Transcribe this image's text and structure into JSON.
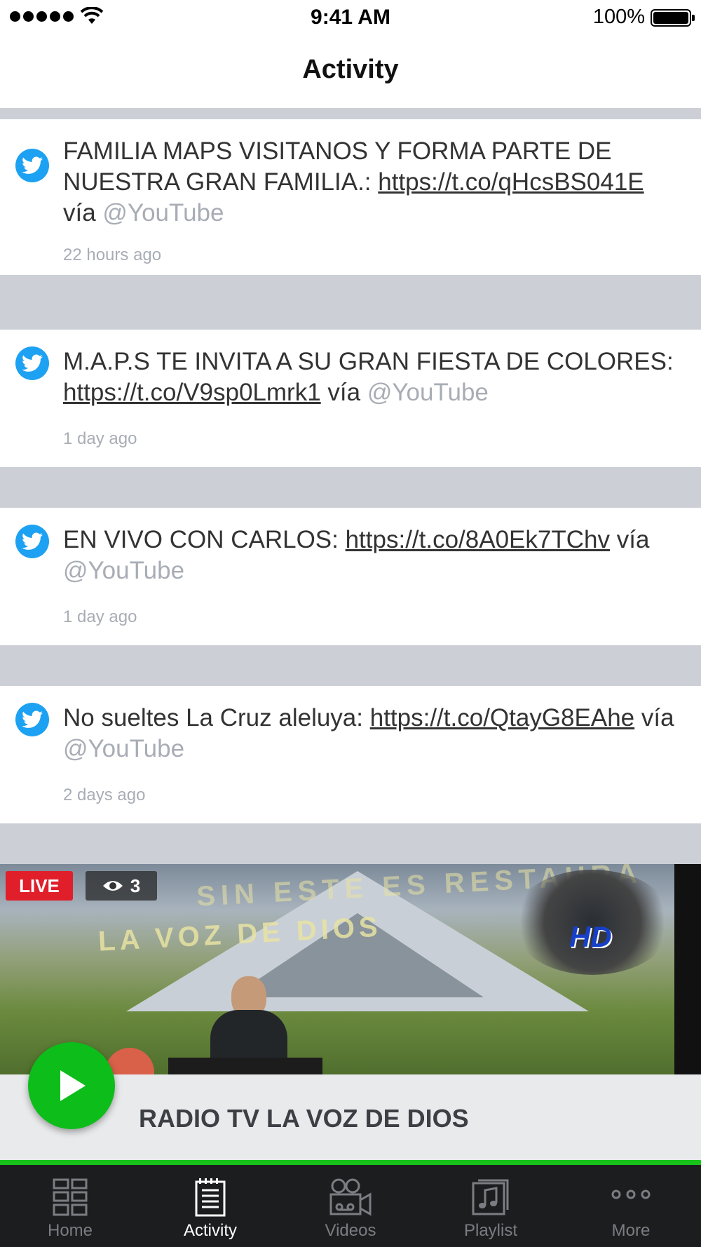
{
  "status_bar": {
    "time": "9:41 AM",
    "battery": "100%"
  },
  "header": {
    "title": "Activity"
  },
  "feed": [
    {
      "segments": [
        {
          "text": "FAMILIA MAPS VISITANOS Y FORMA PARTE DE NUESTRA GRAN FAMILIA.: ",
          "style": "plain"
        },
        {
          "text": "https://t.co/qHcsBS041E",
          "style": "link"
        },
        {
          "text": " vía ",
          "style": "plain"
        },
        {
          "text": "@YouTube",
          "style": "mention"
        }
      ],
      "time": "22 hours ago"
    },
    {
      "segments": [
        {
          "text": "M.A.P.S TE INVITA A SU GRAN FIESTA DE COLORES: ",
          "style": "plain"
        },
        {
          "text": "https://t.co/V9sp0Lmrk1",
          "style": "link"
        },
        {
          "text": " vía ",
          "style": "plain"
        },
        {
          "text": "@YouTube",
          "style": "mention"
        }
      ],
      "time": "1 day ago"
    },
    {
      "segments": [
        {
          "text": "EN VIVO CON CARLOS: ",
          "style": "plain"
        },
        {
          "text": "https://t.co/8A0Ek7TChv",
          "style": "link"
        },
        {
          "text": " vía ",
          "style": "plain"
        },
        {
          "text": "@YouTube",
          "style": "mention"
        }
      ],
      "time": "1 day ago"
    },
    {
      "segments": [
        {
          "text": "No sueltes La Cruz aleluya: ",
          "style": "plain"
        },
        {
          "text": "https://t.co/QtayG8EAhe",
          "style": "link"
        },
        {
          "text": " vía ",
          "style": "plain"
        },
        {
          "text": "@YouTube",
          "style": "mention"
        }
      ],
      "time": "2 days ago"
    }
  ],
  "video": {
    "live_label": "LIVE",
    "viewer_count": "3",
    "overlay_top": "SIN ESTE ES RESTAURA",
    "overlay_title": "LA VOZ DE DIOS",
    "logo_text": "HD"
  },
  "player": {
    "station_name": "RADIO TV LA VOZ DE DIOS"
  },
  "tabs": [
    {
      "label": "Home",
      "icon": "home-grid-icon",
      "active": false
    },
    {
      "label": "Activity",
      "icon": "activity-list-icon",
      "active": true
    },
    {
      "label": "Videos",
      "icon": "video-camera-icon",
      "active": false
    },
    {
      "label": "Playlist",
      "icon": "playlist-music-icon",
      "active": false
    },
    {
      "label": "More",
      "icon": "more-dots-icon",
      "active": false
    }
  ],
  "colors": {
    "twitter_blue": "#1da1f2",
    "play_green": "#0dbd1a",
    "live_red": "#e01f2a",
    "tab_bar": "#1c1d1f"
  }
}
